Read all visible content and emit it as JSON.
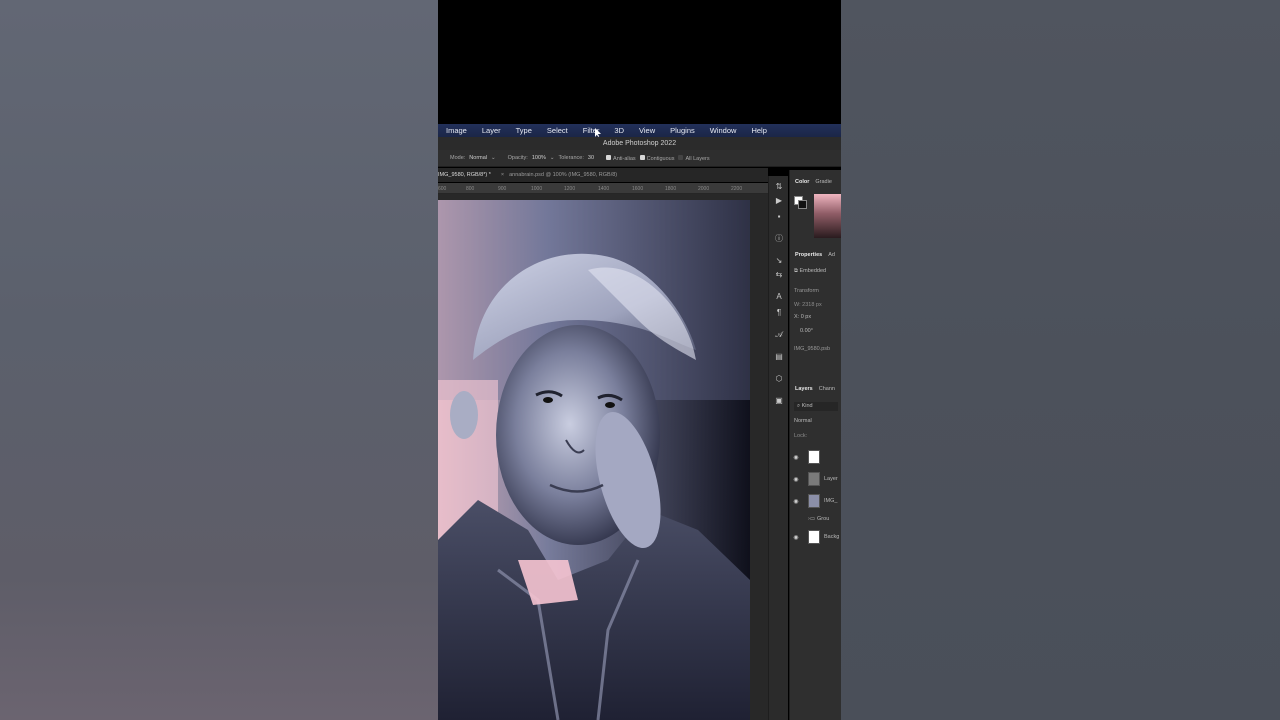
{
  "menu": [
    "Image",
    "Layer",
    "Type",
    "Select",
    "Filter",
    "3D",
    "View",
    "Plugins",
    "Window",
    "Help"
  ],
  "app_title": "Adobe Photoshop 2022",
  "options": {
    "mode_label": "Mode:",
    "mode_value": "Normal",
    "opacity_label": "Opacity:",
    "opacity_value": "100%",
    "tolerance_label": "Tolerance:",
    "tolerance_value": "30",
    "anti_alias": "Anti-alias",
    "contiguous": "Contiguous",
    "all_layers": "All Layers"
  },
  "tabs": {
    "active": "IMG_9580, RGB/8*) *",
    "close_glyph": "×",
    "other": "annabrain.psd @ 100% (IMG_9580, RGB/8)"
  },
  "ruler_ticks": [
    "600",
    "800",
    "900",
    "1000",
    "1200",
    "1400",
    "1600",
    "1800",
    "2000",
    "2200"
  ],
  "panels": {
    "color_tabs": [
      "Color",
      "Gradie"
    ],
    "properties_tabs": [
      "Properties",
      "Ad"
    ],
    "embedded": "Embedded",
    "transform": "Transform",
    "w_value": "W: 2318 px",
    "x_value": "X: 0 px",
    "angle_value": "0.00°",
    "filename": "IMG_9580.psb",
    "layers_tabs": [
      "Layers",
      "Chann"
    ],
    "kind": "Kind",
    "blend": "Normal",
    "lock_label": "Lock:",
    "layers": [
      "",
      "Layer",
      "IMG_",
      "Grou",
      "Backg"
    ]
  },
  "colors": {
    "menubar": "#1b2647",
    "panel": "#2f2f2f",
    "accent_pink": "#f0b5c0"
  }
}
